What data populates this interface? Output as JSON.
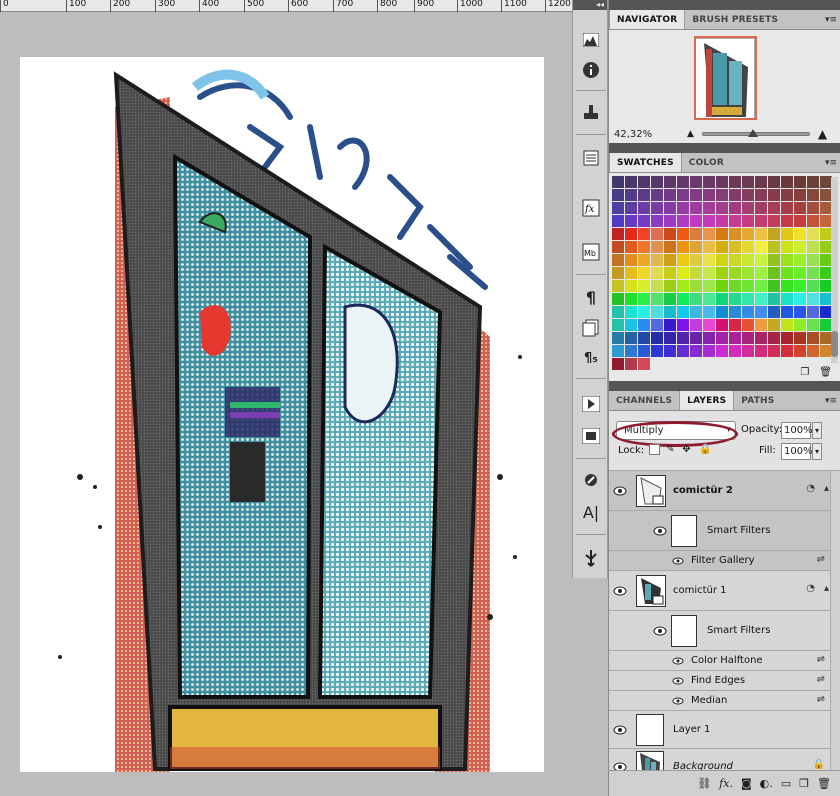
{
  "ruler": {
    "ticks": [
      "0",
      "100",
      "200",
      "300",
      "400",
      "500",
      "600",
      "700",
      "800",
      "900",
      "1000",
      "1100",
      "1200"
    ]
  },
  "navigator": {
    "tabs": [
      "NAVIGATOR",
      "BRUSH PRESETS"
    ],
    "zoom": "42,32%",
    "zoom_level": 0.47
  },
  "swatches": {
    "tabs": [
      "SWATCHES",
      "COLOR"
    ]
  },
  "layers": {
    "tabs": [
      "CHANNELS",
      "LAYERS",
      "PATHS"
    ],
    "blend_mode": "Multiply",
    "opacity_label": "Opacity:",
    "opacity_value": "100%",
    "lock_label": "Lock:",
    "fill_label": "Fill:",
    "fill_value": "100%",
    "items": [
      {
        "name": "comictür 2"
      },
      {
        "name": "Smart Filters"
      },
      {
        "name": "Filter Gallery"
      },
      {
        "name": "comictür 1"
      },
      {
        "name": "Smart Filters"
      },
      {
        "name": "Color Halftone"
      },
      {
        "name": "Find Edges"
      },
      {
        "name": "Median"
      },
      {
        "name": "Layer 1"
      },
      {
        "name": "Background"
      }
    ]
  },
  "icons": {
    "tool_strip": [
      "histogram-icon",
      "info-icon",
      "clone-source-icon",
      "notes-icon",
      "fx-styles-icon",
      "mini-bridge-icon",
      "paragraph-icon",
      "character-styles-icon",
      "paragraph-styles-icon",
      "actions-icon",
      "tool-presets-icon",
      "brush-icon",
      "character-icon",
      "usb-icon"
    ]
  }
}
